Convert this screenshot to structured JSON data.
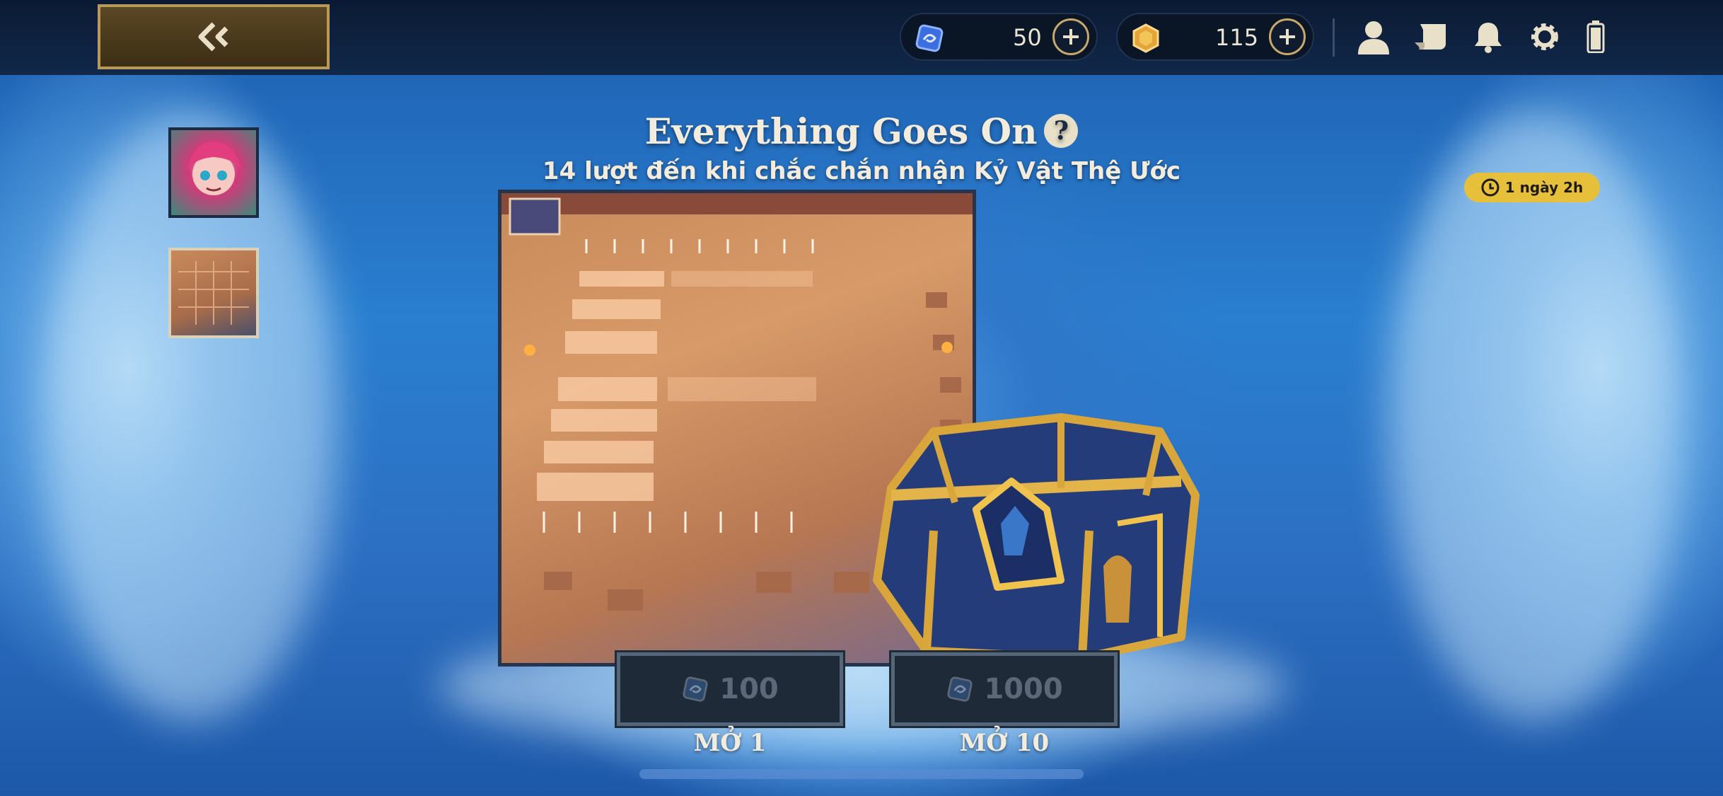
{
  "header": {
    "currency_1": {
      "icon": "essence-icon",
      "value": "50"
    },
    "currency_2": {
      "icon": "gold-coin-icon",
      "value": "115"
    }
  },
  "event": {
    "title": "Everything Goes On",
    "subtitle": "14 lượt đến khi chắc chắn nhận Kỷ Vật Thệ Ước",
    "timer": "1 ngày 2h"
  },
  "buttons": {
    "open_one": {
      "price": "100",
      "label": "MỞ 1"
    },
    "open_ten": {
      "price": "1000",
      "label": "MỞ 10"
    }
  },
  "colors": {
    "accent_gold": "#c9a96a",
    "timer_yellow": "#e6c03a"
  }
}
